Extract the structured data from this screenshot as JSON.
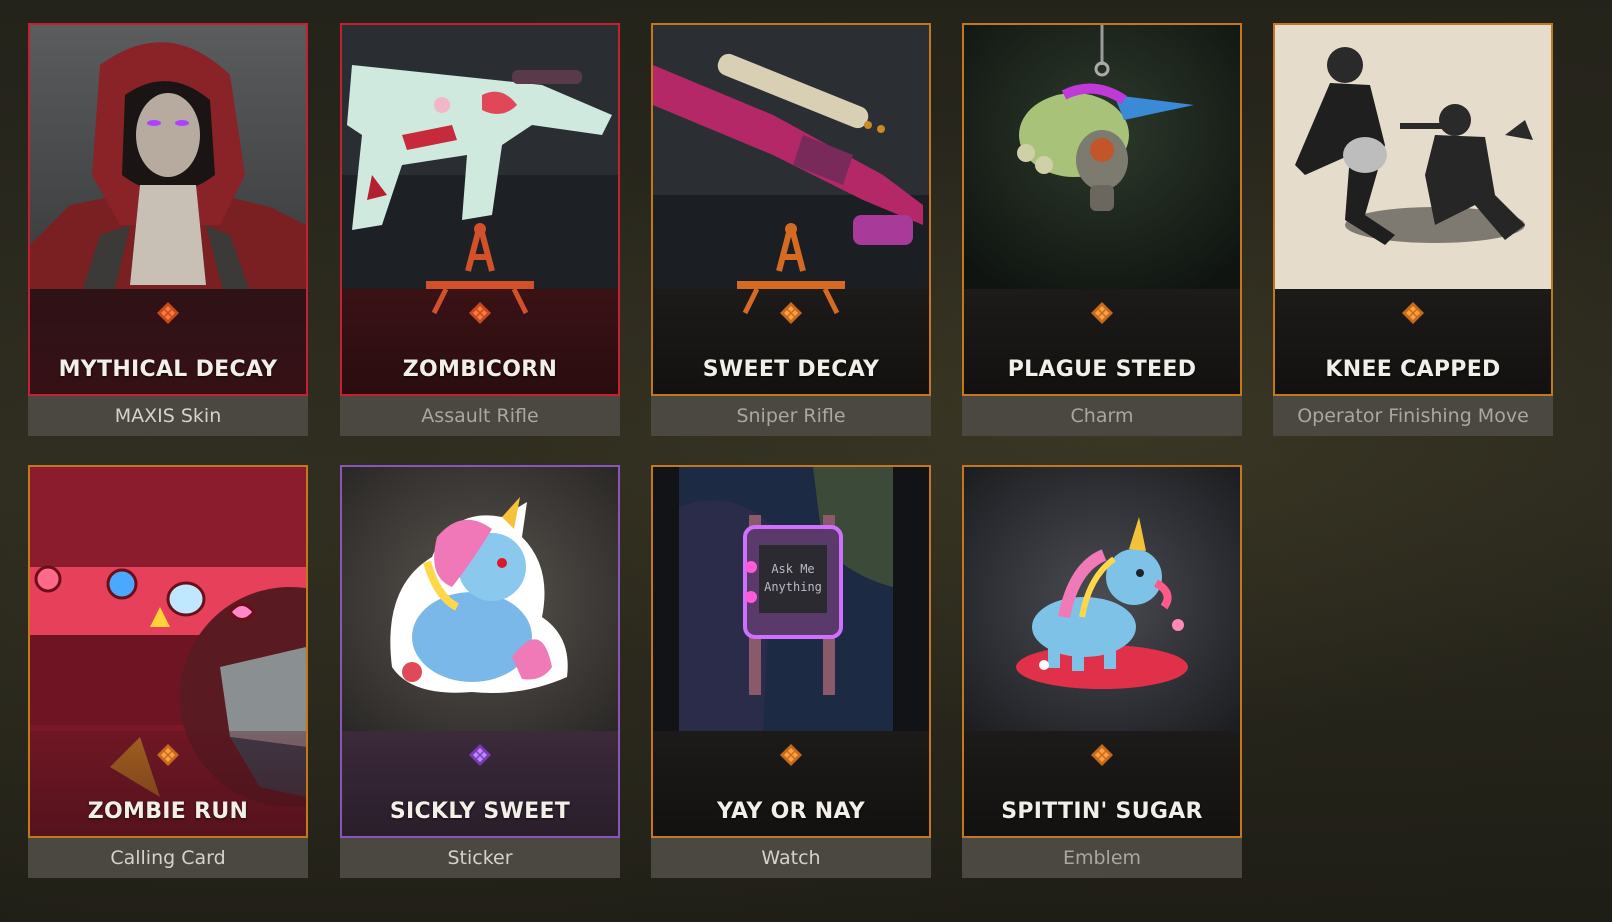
{
  "colors": {
    "rarity_orange": "#c3781f",
    "rarity_red": "#c4202f",
    "rarity_purple": "#8a55b8",
    "type_bar": "#4a4840"
  },
  "items": [
    {
      "name": "MYTHICAL DECAY",
      "type": "MAXIS Skin",
      "rarity_icon": "orange-diamond-rarity-icon",
      "art": "red-hooded-operator"
    },
    {
      "name": "ZOMBICORN",
      "type": "Assault Rifle",
      "rarity_icon": "orange-diamond-rarity-icon",
      "art": "assault-rifle-blueprint"
    },
    {
      "name": "SWEET DECAY",
      "type": "Sniper Rifle",
      "rarity_icon": "orange-diamond-rarity-icon",
      "art": "sniper-rifle-blueprint"
    },
    {
      "name": "PLAGUE STEED",
      "type": "Charm",
      "rarity_icon": "orange-diamond-rarity-icon",
      "art": "unicorn-gasmask-charm"
    },
    {
      "name": "KNEE CAPPED",
      "type": "Operator Finishing Move",
      "rarity_icon": "orange-diamond-rarity-icon",
      "art": "finishing-move-illustration"
    },
    {
      "name": "ZOMBIE RUN",
      "type": "Calling Card",
      "rarity_icon": "orange-diamond-rarity-icon",
      "art": "candy-calling-card"
    },
    {
      "name": "SICKLY SWEET",
      "type": "Sticker",
      "rarity_icon": "purple-diamond-rarity-icon",
      "art": "zombie-unicorn-sticker"
    },
    {
      "name": "YAY OR NAY",
      "type": "Watch",
      "rarity_icon": "orange-diamond-rarity-icon",
      "art": "watch-on-wrist"
    },
    {
      "name": "SPITTIN' SUGAR",
      "type": "Emblem",
      "rarity_icon": "orange-diamond-rarity-icon",
      "art": "unicorn-emblem"
    }
  ],
  "blueprint_mark_icon": "compass-blueprint-icon",
  "watch_screen_text": [
    "Ask Me",
    "Anything"
  ]
}
